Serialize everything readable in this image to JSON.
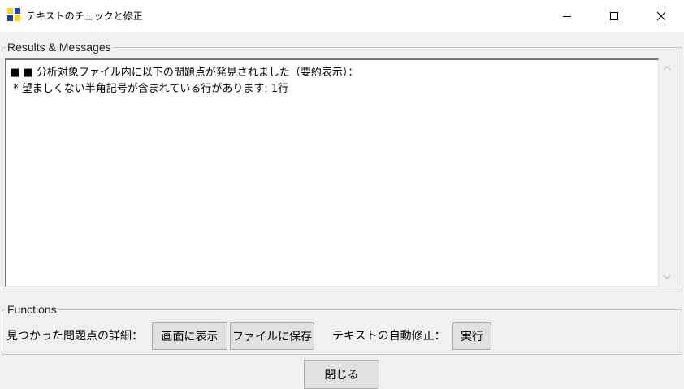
{
  "window": {
    "title": "テキストのチェックと修正",
    "icon": "app-grid-icon",
    "controls": {
      "minimize": "minimize-icon",
      "maximize": "maximize-icon",
      "close": "close-icon"
    }
  },
  "results": {
    "legend": "Results & Messages",
    "lines": [
      "■ ■ 分析対象ファイル内に以下の問題点が発見されました（要約表示）：",
      " * 望ましくない半角記号が含まれている行があります: 1行"
    ]
  },
  "functions": {
    "legend": "Functions",
    "details_label": "見つかった問題点の詳細：",
    "show_button": "画面に表示",
    "save_button": "ファイルに保存",
    "autofix_label": "テキストの自動修正：",
    "run_button": "実行"
  },
  "close_button": "閉じる",
  "colors": {
    "icon_yellow": "#ffd800",
    "icon_blue": "#1a3fbf",
    "background": "#f0f0f0"
  }
}
